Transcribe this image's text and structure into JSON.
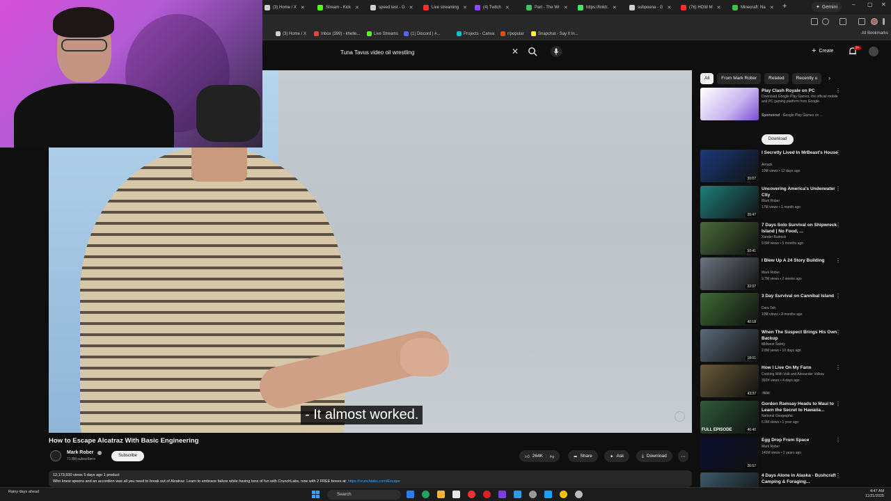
{
  "browser": {
    "tabs": [
      {
        "label": "(3) Home / X",
        "color": "#cfcfcf"
      },
      {
        "label": "Stream - Kick",
        "color": "#53fc18"
      },
      {
        "label": "speed test - G",
        "color": "#d0d0d0"
      },
      {
        "label": "Live streaming",
        "color": "#ff2a2a"
      },
      {
        "label": "(4) Twitch",
        "color": "#9146ff"
      },
      {
        "label": "Part - The Wr",
        "color": "#40c060"
      },
      {
        "label": "https://linktr.",
        "color": "#43e660"
      },
      {
        "label": "subpoena - G",
        "color": "#d0d0d0"
      },
      {
        "label": "(76) HOW M",
        "color": "#ff2a2a"
      },
      {
        "label": "Minecraft: Na",
        "color": "#3bbf40"
      }
    ],
    "gemini_label": "Gemini",
    "bookmarks": [
      {
        "label": "(3) Home / X",
        "color": "#cfcfcf"
      },
      {
        "label": "Inbox (399) - khelle...",
        "color": "#ea4335"
      },
      {
        "label": "Live Streams",
        "color": "#53fc18"
      },
      {
        "label": "(1) Discord | #...",
        "color": "#5865f2"
      },
      {
        "label": "Projects - Canva",
        "color": "#00c4cc"
      },
      {
        "label": "r/popular",
        "color": "#ff4500"
      },
      {
        "label": "Snapchat - Say It In...",
        "color": "#fffc00"
      }
    ],
    "all_bookmarks": "All Bookmarks"
  },
  "header": {
    "search_query": "Tuna Tavus video oil wrestling",
    "create_label": "Create",
    "notification_count": "9+"
  },
  "player": {
    "caption": "- It almost worked."
  },
  "video": {
    "title": "How to Escape Alcatraz With Basic Engineering",
    "channel": "Mark Rober",
    "subscribers": "71.8M subscribers",
    "subscribe_label": "Subscribe",
    "likes": "264K",
    "share_label": "Share",
    "ask_label": "Ask",
    "download_label": "Download",
    "meta": "12,173,930 views  5 days ago  1 product",
    "description": "Who knew spoons and an accordion was all you need to break out of Alcatraz. Learn to embrace failure while having tons of fun with CrunchLabs, now with 2 FREE boxes at:",
    "link": "https://crunchlabs.com/Escape"
  },
  "chips": [
    "All",
    "From Mark Rober",
    "Related",
    "Recently u"
  ],
  "ad": {
    "title": "Play Clash Royale on PC",
    "description": "Download Google Play Games, the official mobile and PC gaming platform from Google.",
    "sponsored": "Sponsored",
    "advertiser": "Google Play Games on ...",
    "download_label": "Download"
  },
  "recommendations": [
    {
      "title": "I Secretly Lived In MrBeast's House",
      "channel": "Airrack",
      "meta": "10M views • 12 days ago",
      "duration": "30:07",
      "color": "#1a3a7a"
    },
    {
      "title": "Uncovering America's Underwater City",
      "channel": "Mark Rober",
      "meta": "17M views • 1 month ago",
      "duration": "20:47",
      "color": "#1f7d7a"
    },
    {
      "title": "7 Days Solo Survival on Shipwreck Island | No Food, ...",
      "channel": "Xander Budnick",
      "meta": "9.5M views • 5 months ago",
      "duration": "50:41",
      "color": "#4a6a3a"
    },
    {
      "title": "I Blew Up A 24 Story Building",
      "channel": "Mark Rober",
      "meta": "9.7M views • 2 weeks ago",
      "duration": "22:07",
      "color": "#6c7480"
    },
    {
      "title": "3 Day Survival on Cannibal Island",
      "channel": "Dara Tah",
      "meta": "10M views • 2 months ago",
      "duration": "40:18",
      "color": "#3f6b35"
    },
    {
      "title": "When The Suspect Brings His Own Backup",
      "channel": "Midwest Safety",
      "meta": "2.8M views • 10 days ago",
      "duration": "18:01",
      "color": "#5a6a7a"
    },
    {
      "title": "How I Live On My Farm",
      "channel": "Cooking With Volk and Alexander Volkov",
      "meta": "392K views • 4 days ago",
      "duration": "43:37",
      "color": "#6a5a3a",
      "badge": "New"
    },
    {
      "title": "Gordon Ramsay Heads to Maui to Learn the Secret to Hawaiia...",
      "channel": "National Geographic",
      "meta": "6.9M views • 1 year ago",
      "duration": "46:40",
      "color": "#2f5a3a",
      "overlay": "FULL EPISODE"
    },
    {
      "title": "Egg Drop From Space",
      "channel": "Mark Rober",
      "meta": "140M views • 2 years ago",
      "duration": "26:57",
      "color": "#0c1030"
    },
    {
      "title": "4 Days Alone in Alaska - Bushcraft Camping & Foraging...",
      "channel": "",
      "meta": "",
      "duration": "",
      "color": "#3a5a6a"
    }
  ],
  "taskbar": {
    "weather": "Rainy days ahead",
    "search_label": "Search",
    "time": "4:47 AM",
    "date": "11/21/2025"
  }
}
